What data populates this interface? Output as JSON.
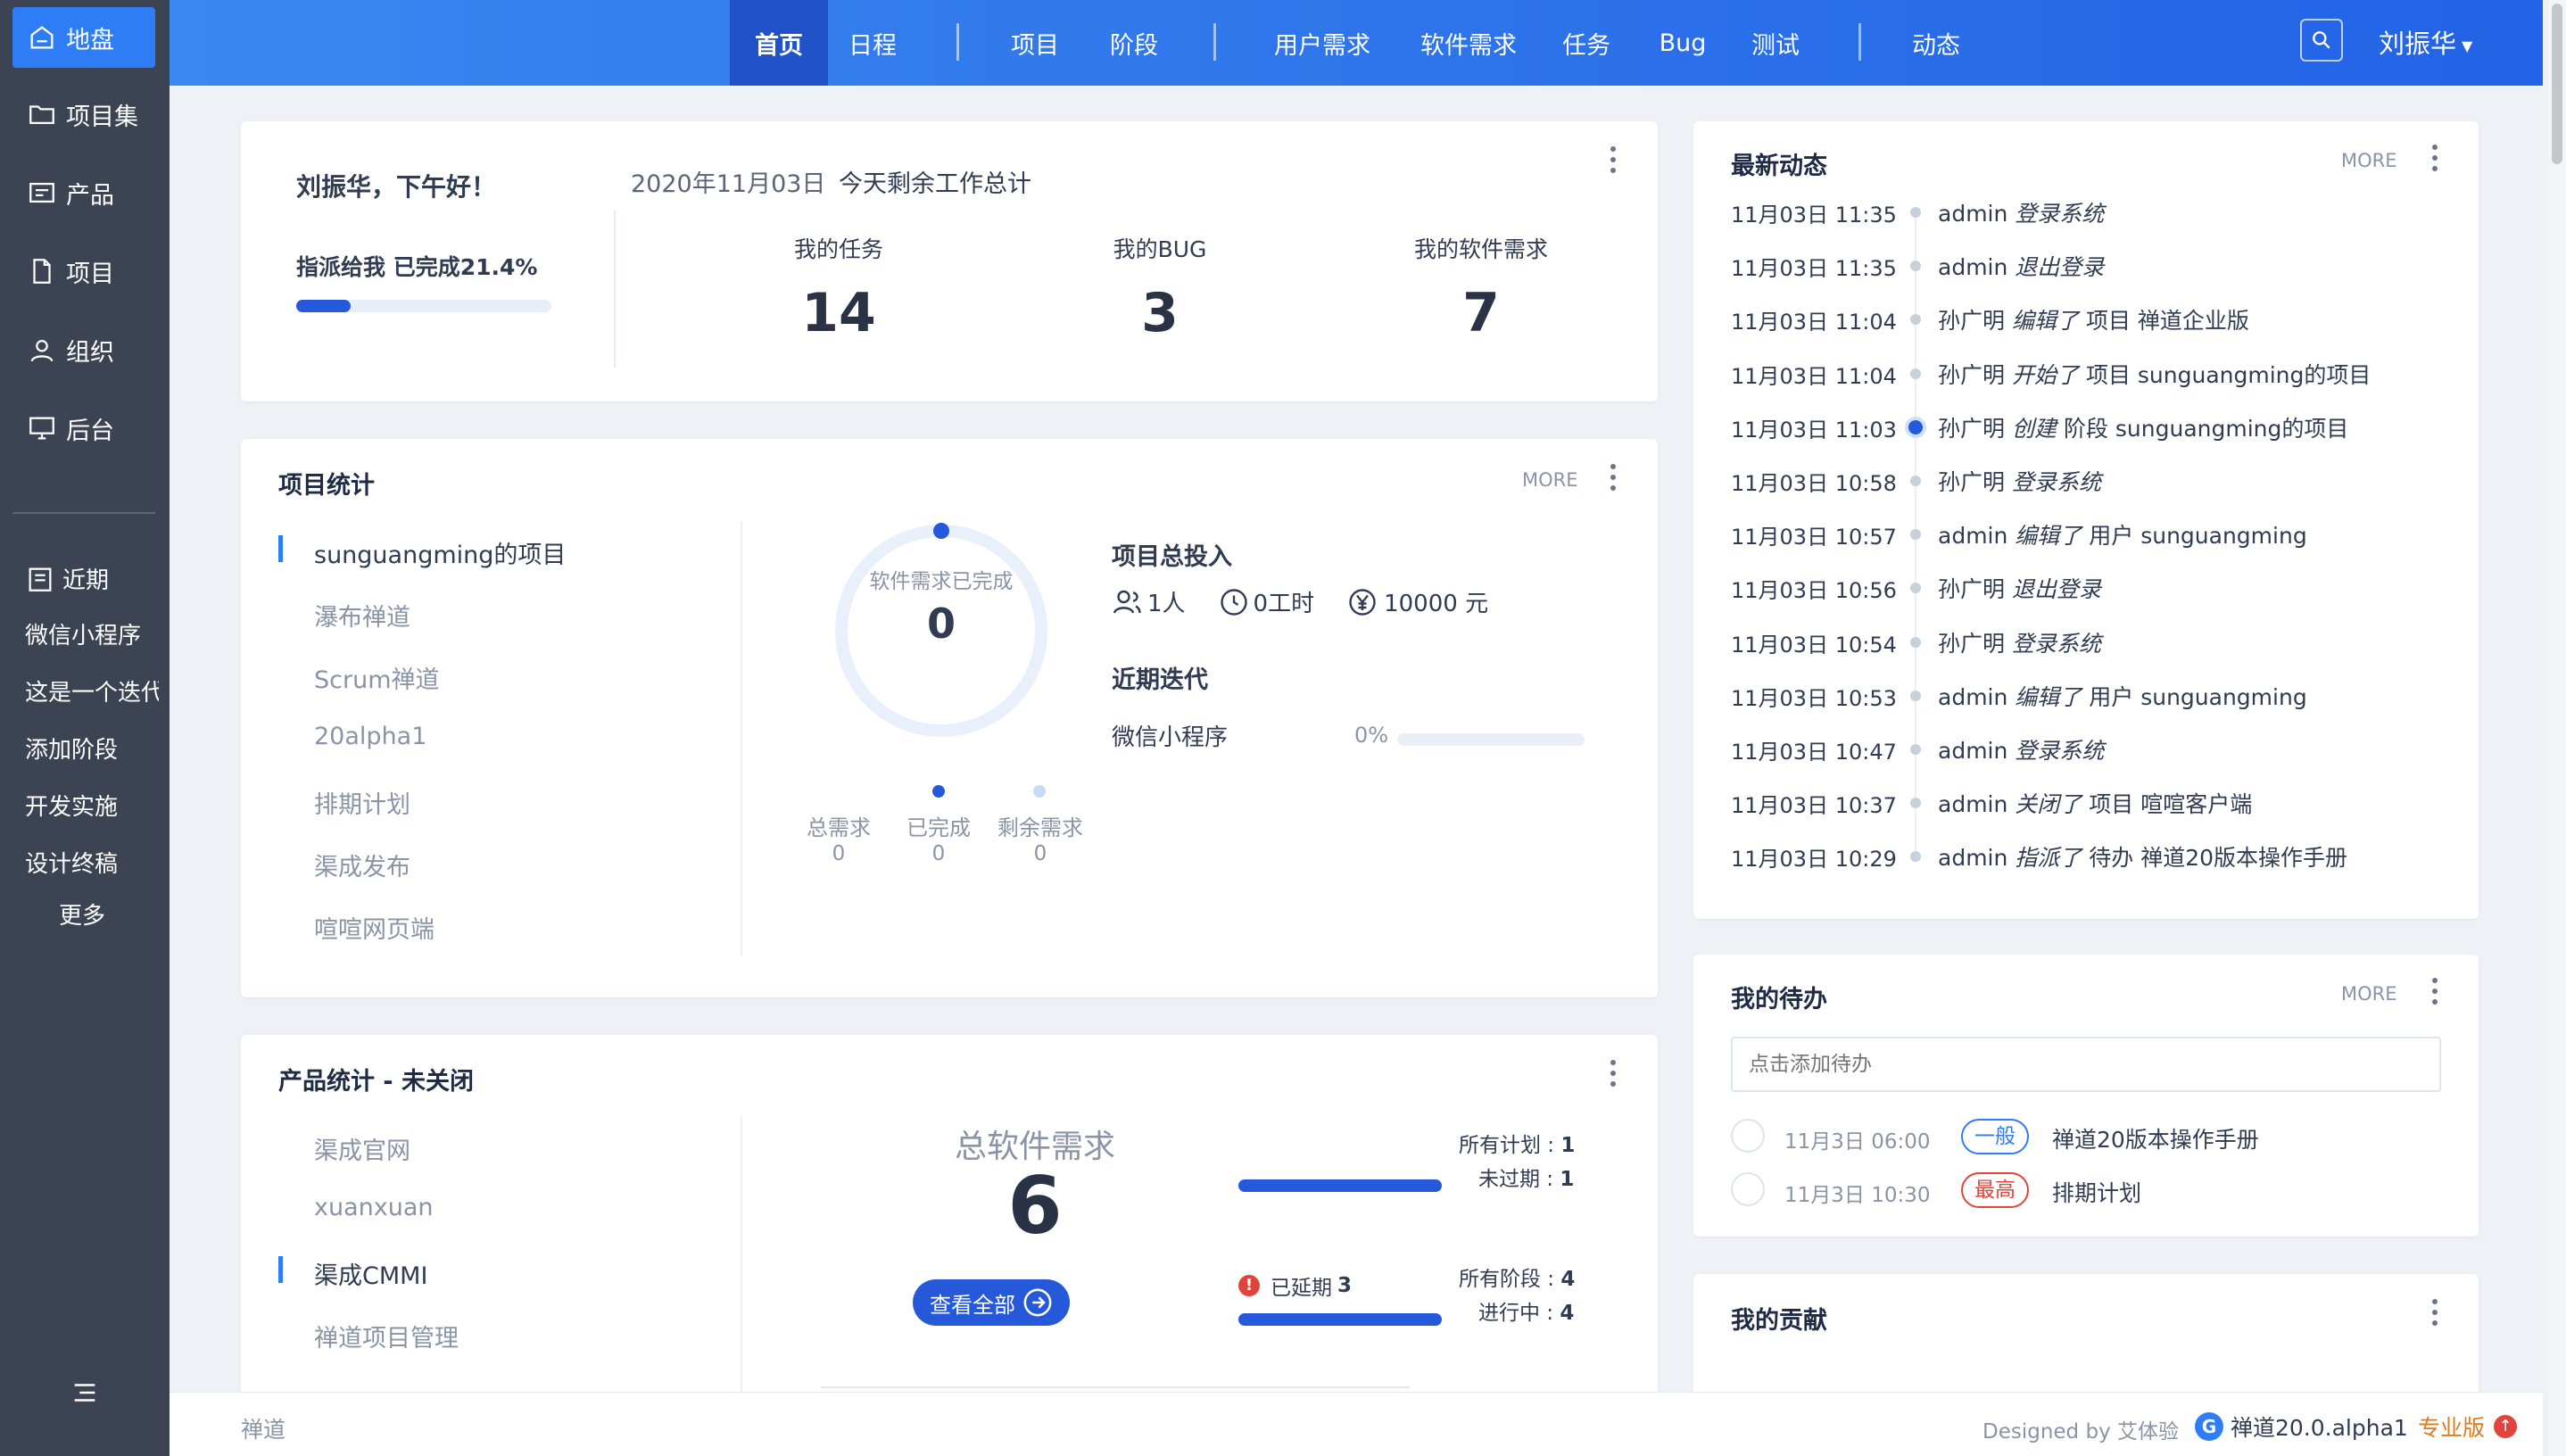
{
  "sidebar": {
    "items": [
      {
        "label": "地盘",
        "icon": "home-icon"
      },
      {
        "label": "项目集",
        "icon": "folder-icon"
      },
      {
        "label": "产品",
        "icon": "product-icon"
      },
      {
        "label": "项目",
        "icon": "file-icon"
      },
      {
        "label": "组织",
        "icon": "user-icon"
      },
      {
        "label": "后台",
        "icon": "monitor-icon"
      }
    ],
    "recent_label": "近期",
    "recent_items": [
      "微信小程序",
      "这是一个迭代",
      "添加阶段",
      "开发实施",
      "设计终稿"
    ],
    "more_label": "更多"
  },
  "topnav": {
    "items": [
      "首页",
      "日程",
      "项目",
      "阶段",
      "用户需求",
      "软件需求",
      "任务",
      "Bug",
      "测试",
      "动态"
    ],
    "active": "首页",
    "user": "刘振华"
  },
  "welcome": {
    "greeting": "刘振华，下午好！",
    "progress_label": "指派给我 已完成21.4%",
    "progress_pct": 21.4,
    "date": "2020年11月03日",
    "summary": "今天剩余工作总计",
    "stats": [
      {
        "label": "我的任务",
        "value": "14"
      },
      {
        "label": "我的BUG",
        "value": "3"
      },
      {
        "label": "我的软件需求",
        "value": "7"
      }
    ]
  },
  "project_stats": {
    "title": "项目统计",
    "more": "MORE",
    "projects": [
      "sunguangming的项目",
      "瀑布禅道",
      "Scrum禅道",
      "20alpha1",
      "排期计划",
      "渠成发布",
      "喧喧网页端"
    ],
    "ring_label": "软件需求已完成",
    "ring_value": "0",
    "legend": [
      {
        "label": "总需求",
        "value": "0"
      },
      {
        "label": "已完成",
        "value": "0"
      },
      {
        "label": "剩余需求",
        "value": "0"
      }
    ],
    "invest_title": "项目总投入",
    "invest_people": "1人",
    "invest_hours": "0工时",
    "invest_money": "10000 元",
    "iteration_title": "近期迭代",
    "iteration_name": "微信小程序",
    "iteration_pct": "0%"
  },
  "product_stats": {
    "title": "产品统计 - 未关闭",
    "products": [
      "渠成官网",
      "xuanxuan",
      "渠成CMMI",
      "禅道项目管理"
    ],
    "total_label": "总软件需求",
    "total_value": "6",
    "view_all": "查看全部",
    "plans_all_label": "所有计划 : ",
    "plans_all": "1",
    "plans_unexpired_label": "未过期 : ",
    "plans_unexpired": "1",
    "delayed_label": "已延期 ",
    "delayed": "3",
    "stages_all_label": "所有阶段 : ",
    "stages_all": "4",
    "stages_ongoing_label": "进行中 : ",
    "stages_ongoing": "4"
  },
  "dynamics": {
    "title": "最新动态",
    "more": "MORE",
    "items": [
      {
        "time": "11月03日 11:35",
        "user": "admin",
        "action": "登录系统",
        "object": ""
      },
      {
        "time": "11月03日 11:35",
        "user": "admin",
        "action": "退出登录",
        "object": ""
      },
      {
        "time": "11月03日 11:04",
        "user": "孙广明",
        "action": "编辑了",
        "object": "项目 禅道企业版"
      },
      {
        "time": "11月03日 11:04",
        "user": "孙广明",
        "action": "开始了",
        "object": "项目 sunguangming的项目"
      },
      {
        "time": "11月03日 11:03",
        "user": "孙广明",
        "action": "创建",
        "object": "阶段 sunguangming的项目"
      },
      {
        "time": "11月03日 10:58",
        "user": "孙广明",
        "action": "登录系统",
        "object": ""
      },
      {
        "time": "11月03日 10:57",
        "user": "admin",
        "action": "编辑了",
        "object": "用户 sunguangming"
      },
      {
        "time": "11月03日 10:56",
        "user": "孙广明",
        "action": "退出登录",
        "object": ""
      },
      {
        "time": "11月03日 10:54",
        "user": "孙广明",
        "action": "登录系统",
        "object": ""
      },
      {
        "time": "11月03日 10:53",
        "user": "admin",
        "action": "编辑了",
        "object": "用户 sunguangming"
      },
      {
        "time": "11月03日 10:47",
        "user": "admin",
        "action": "登录系统",
        "object": ""
      },
      {
        "time": "11月03日 10:37",
        "user": "admin",
        "action": "关闭了",
        "object": "项目 喧喧客户端"
      },
      {
        "time": "11月03日 10:29",
        "user": "admin",
        "action": "指派了",
        "object": "待办 禅道20版本操作手册"
      }
    ]
  },
  "todo": {
    "title": "我的待办",
    "more": "MORE",
    "placeholder": "点击添加待办",
    "items": [
      {
        "time": "11月3日 06:00",
        "priority": "一般",
        "priority_color": "#2e7cf6",
        "name": "禅道20版本操作手册"
      },
      {
        "time": "11月3日 10:30",
        "priority": "最高",
        "priority_color": "#e0443a",
        "name": "排期计划"
      }
    ]
  },
  "contribution": {
    "title": "我的贡献"
  },
  "footer": {
    "left": "禅道",
    "designed": "Designed by 艾体验",
    "version": "禅道20.0.alpha1",
    "edition": "专业版"
  }
}
